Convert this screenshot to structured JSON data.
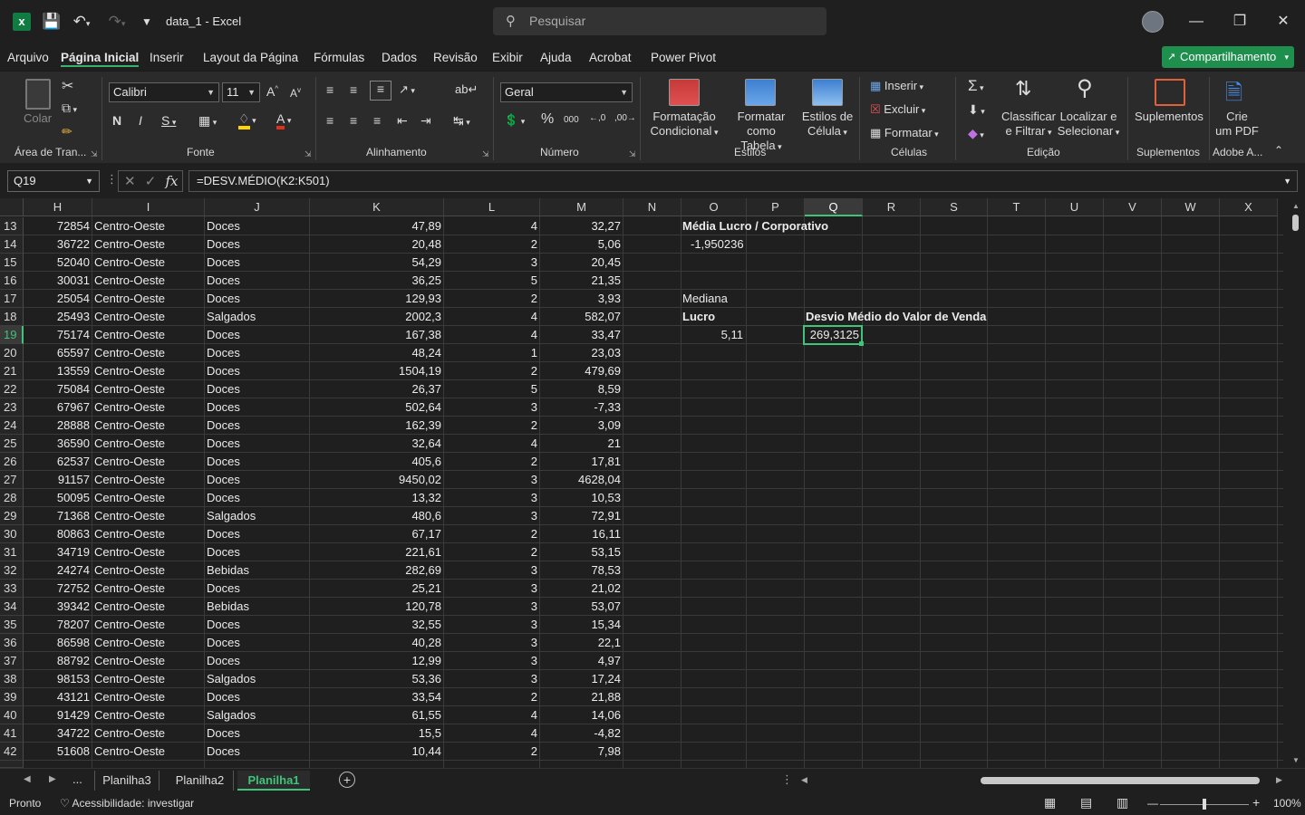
{
  "window": {
    "doc_title": "data_1  -  Excel",
    "search_placeholder": "Pesquisar"
  },
  "menu": {
    "items": [
      "Arquivo",
      "Página Inicial",
      "Inserir",
      "Layout da Página",
      "Fórmulas",
      "Dados",
      "Revisão",
      "Exibir",
      "Ajuda",
      "Acrobat",
      "Power Pivot"
    ],
    "active": "Página Inicial",
    "share_label": "Compartilhamento"
  },
  "ribbon": {
    "clipboard": {
      "paste_label": "Colar",
      "group": "Área de Tran..."
    },
    "font": {
      "name": "Calibri",
      "size": "11",
      "group": "Fonte"
    },
    "alignment": {
      "group": "Alinhamento"
    },
    "number": {
      "format": "Geral",
      "group": "Número"
    },
    "styles": {
      "cond_format": [
        "Formatação",
        "Condicional"
      ],
      "format_table": [
        "Formatar como",
        "Tabela"
      ],
      "cell_styles": [
        "Estilos de",
        "Célula"
      ],
      "group": "Estilos"
    },
    "cells": {
      "insert": "Inserir",
      "delete": "Excluir",
      "format": "Formatar",
      "group": "Células"
    },
    "editing": {
      "sort": [
        "Classificar",
        "e Filtrar"
      ],
      "find": [
        "Localizar e",
        "Selecionar"
      ],
      "group": "Edição"
    },
    "addins": {
      "label": "Suplementos",
      "group": "Suplementos"
    },
    "adobe": {
      "label": [
        "Crie",
        "um PDF"
      ],
      "group": "Adobe A..."
    }
  },
  "formula_bar": {
    "name_box": "Q19",
    "formula": "=DESV.MÉDIO(K2:K501)"
  },
  "columns": [
    "H",
    "I",
    "J",
    "K",
    "L",
    "M",
    "N",
    "O",
    "P",
    "Q",
    "R",
    "S",
    "T",
    "U",
    "V",
    "W",
    "X"
  ],
  "selected_column": "Q",
  "selected_row": "19",
  "rows": [
    {
      "n": "13",
      "H": "72854",
      "I": "Centro-Oeste",
      "J": "Doces",
      "K": "47,89",
      "L": "4",
      "M": "32,27"
    },
    {
      "n": "14",
      "H": "36722",
      "I": "Centro-Oeste",
      "J": "Doces",
      "K": "20,48",
      "L": "2",
      "M": "5,06"
    },
    {
      "n": "15",
      "H": "52040",
      "I": "Centro-Oeste",
      "J": "Doces",
      "K": "54,29",
      "L": "3",
      "M": "20,45"
    },
    {
      "n": "16",
      "H": "30031",
      "I": "Centro-Oeste",
      "J": "Doces",
      "K": "36,25",
      "L": "5",
      "M": "21,35"
    },
    {
      "n": "17",
      "H": "25054",
      "I": "Centro-Oeste",
      "J": "Doces",
      "K": "129,93",
      "L": "2",
      "M": "3,93"
    },
    {
      "n": "18",
      "H": "25493",
      "I": "Centro-Oeste",
      "J": "Salgados",
      "K": "2002,3",
      "L": "4",
      "M": "582,07"
    },
    {
      "n": "19",
      "H": "75174",
      "I": "Centro-Oeste",
      "J": "Doces",
      "K": "167,38",
      "L": "4",
      "M": "33,47"
    },
    {
      "n": "20",
      "H": "65597",
      "I": "Centro-Oeste",
      "J": "Doces",
      "K": "48,24",
      "L": "1",
      "M": "23,03"
    },
    {
      "n": "21",
      "H": "13559",
      "I": "Centro-Oeste",
      "J": "Doces",
      "K": "1504,19",
      "L": "2",
      "M": "479,69"
    },
    {
      "n": "22",
      "H": "75084",
      "I": "Centro-Oeste",
      "J": "Doces",
      "K": "26,37",
      "L": "5",
      "M": "8,59"
    },
    {
      "n": "23",
      "H": "67967",
      "I": "Centro-Oeste",
      "J": "Doces",
      "K": "502,64",
      "L": "3",
      "M": "-7,33"
    },
    {
      "n": "24",
      "H": "28888",
      "I": "Centro-Oeste",
      "J": "Doces",
      "K": "162,39",
      "L": "2",
      "M": "3,09"
    },
    {
      "n": "25",
      "H": "36590",
      "I": "Centro-Oeste",
      "J": "Doces",
      "K": "32,64",
      "L": "4",
      "M": "21"
    },
    {
      "n": "26",
      "H": "62537",
      "I": "Centro-Oeste",
      "J": "Doces",
      "K": "405,6",
      "L": "2",
      "M": "17,81"
    },
    {
      "n": "27",
      "H": "91157",
      "I": "Centro-Oeste",
      "J": "Doces",
      "K": "9450,02",
      "L": "3",
      "M": "4628,04"
    },
    {
      "n": "28",
      "H": "50095",
      "I": "Centro-Oeste",
      "J": "Doces",
      "K": "13,32",
      "L": "3",
      "M": "10,53"
    },
    {
      "n": "29",
      "H": "71368",
      "I": "Centro-Oeste",
      "J": "Salgados",
      "K": "480,6",
      "L": "3",
      "M": "72,91"
    },
    {
      "n": "30",
      "H": "80863",
      "I": "Centro-Oeste",
      "J": "Doces",
      "K": "67,17",
      "L": "2",
      "M": "16,11"
    },
    {
      "n": "31",
      "H": "34719",
      "I": "Centro-Oeste",
      "J": "Doces",
      "K": "221,61",
      "L": "2",
      "M": "53,15"
    },
    {
      "n": "32",
      "H": "24274",
      "I": "Centro-Oeste",
      "J": "Bebidas",
      "K": "282,69",
      "L": "3",
      "M": "78,53"
    },
    {
      "n": "33",
      "H": "72752",
      "I": "Centro-Oeste",
      "J": "Doces",
      "K": "25,21",
      "L": "3",
      "M": "21,02"
    },
    {
      "n": "34",
      "H": "39342",
      "I": "Centro-Oeste",
      "J": "Bebidas",
      "K": "120,78",
      "L": "3",
      "M": "53,07"
    },
    {
      "n": "35",
      "H": "78207",
      "I": "Centro-Oeste",
      "J": "Doces",
      "K": "32,55",
      "L": "3",
      "M": "15,34"
    },
    {
      "n": "36",
      "H": "86598",
      "I": "Centro-Oeste",
      "J": "Doces",
      "K": "40,28",
      "L": "3",
      "M": "22,1"
    },
    {
      "n": "37",
      "H": "88792",
      "I": "Centro-Oeste",
      "J": "Doces",
      "K": "12,99",
      "L": "3",
      "M": "4,97"
    },
    {
      "n": "38",
      "H": "98153",
      "I": "Centro-Oeste",
      "J": "Salgados",
      "K": "53,36",
      "L": "3",
      "M": "17,24"
    },
    {
      "n": "39",
      "H": "43121",
      "I": "Centro-Oeste",
      "J": "Doces",
      "K": "33,54",
      "L": "2",
      "M": "21,88"
    },
    {
      "n": "40",
      "H": "91429",
      "I": "Centro-Oeste",
      "J": "Salgados",
      "K": "61,55",
      "L": "4",
      "M": "14,06"
    },
    {
      "n": "41",
      "H": "34722",
      "I": "Centro-Oeste",
      "J": "Doces",
      "K": "15,5",
      "L": "4",
      "M": "-4,82"
    },
    {
      "n": "42",
      "H": "51608",
      "I": "Centro-Oeste",
      "J": "Doces",
      "K": "10,44",
      "L": "2",
      "M": "7,98"
    }
  ],
  "side_cells": {
    "media_title": "Média Lucro / Corporativo",
    "media_value": "-1,950236",
    "mediana_label": "Mediana",
    "lucro_label": "Lucro",
    "lucro_value": "5,11",
    "desvio_title": "Desvio Médio do Valor de Venda",
    "desvio_value": "269,3125"
  },
  "sheet_tabs": [
    "Planilha3",
    "Planilha2",
    "Planilha1"
  ],
  "active_sheet": "Planilha1",
  "status": {
    "ready": "Pronto",
    "accessibility": "Acessibilidade: investigar",
    "zoom": "100%"
  }
}
